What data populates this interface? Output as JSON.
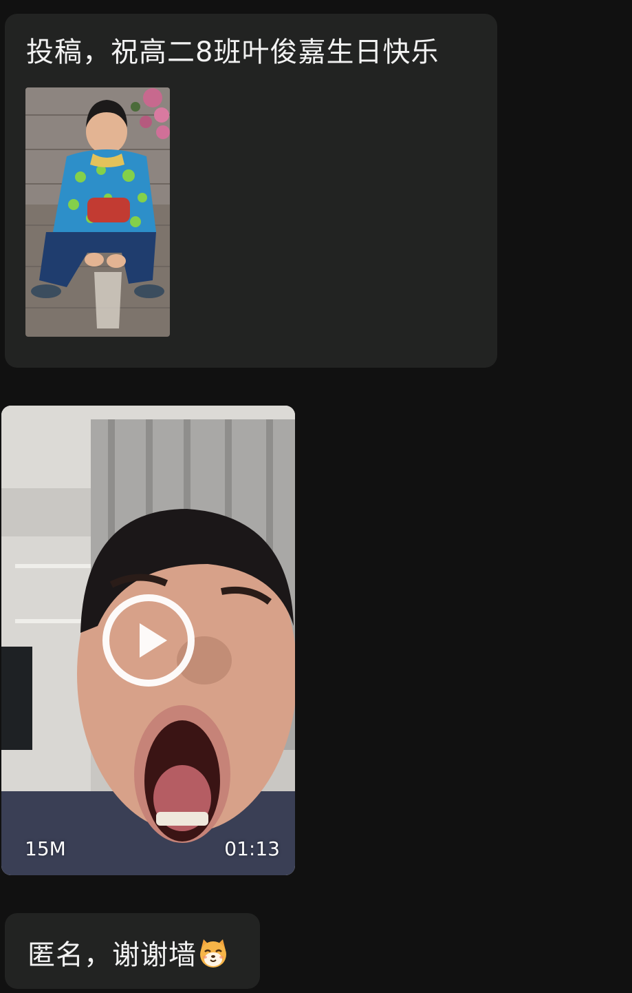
{
  "messages": [
    {
      "type": "text_with_image",
      "text": "投稿，祝高二8班叶俊嘉生日快乐",
      "image": "photo of boy crouching wearing blue patterned jacket"
    },
    {
      "type": "video",
      "thumbnail": "blurry close-up of man with wide open mouth",
      "size": "15M",
      "duration": "01:13",
      "play_icon": "play-circle-icon"
    },
    {
      "type": "text",
      "text": "匿名，谢谢墙",
      "emoji": "smiling-shiba-emoji"
    }
  ]
}
